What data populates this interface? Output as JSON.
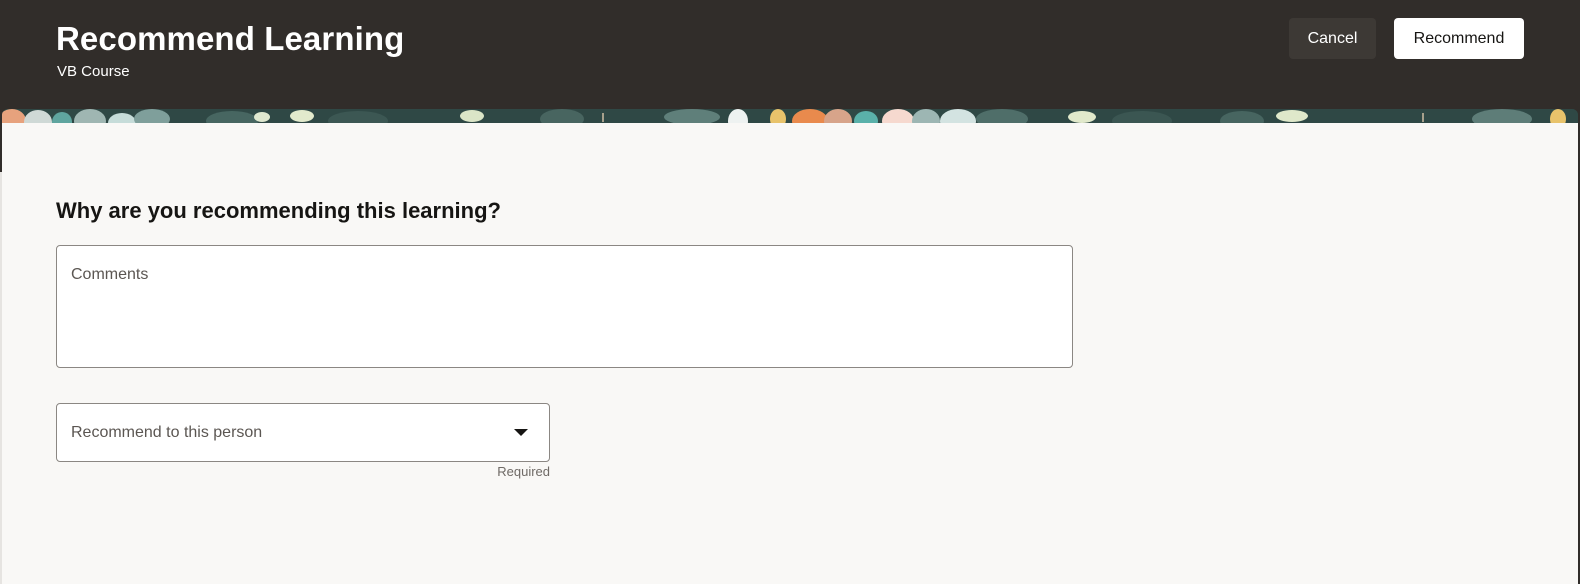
{
  "header": {
    "title": "Recommend Learning",
    "subtitle": "VB Course",
    "cancel_label": "Cancel",
    "recommend_label": "Recommend"
  },
  "form": {
    "question": "Why are you recommending this learning?",
    "comments_placeholder": "Comments",
    "comments_value": "",
    "person_placeholder": "Recommend to this person",
    "person_value": "",
    "required_text": "Required"
  },
  "colors": {
    "header_bg": "#312d2a",
    "content_bg": "#f9f8f6",
    "primary_button_bg": "#ffffff",
    "secondary_button_bg": "#3d3935"
  },
  "icons": {
    "dropdown": "chevron-down-icon"
  }
}
